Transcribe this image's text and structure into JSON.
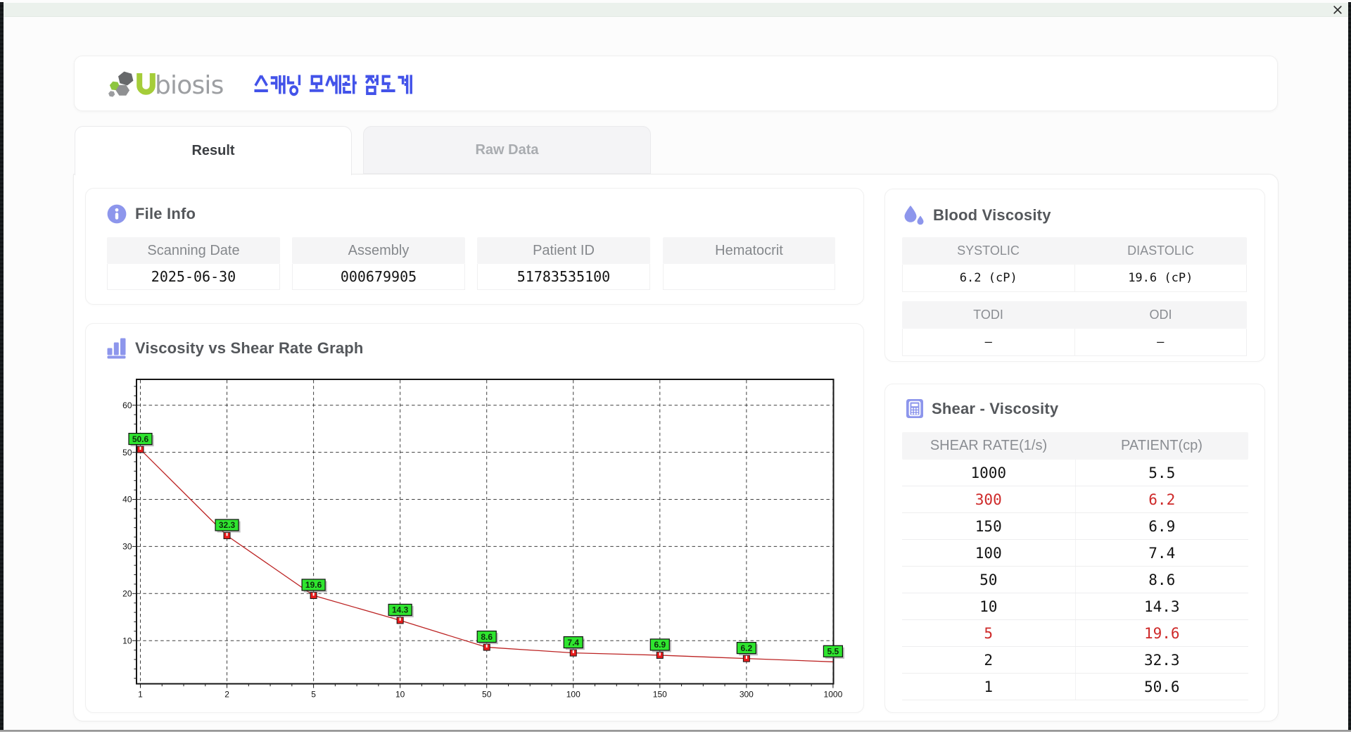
{
  "window": {
    "titlebar_color": "#ebf1ec",
    "close_label": "close"
  },
  "header": {
    "logo_u": "U",
    "logo_rest": "biosis",
    "app_title_korean": "스캐닝 모세관 점도계"
  },
  "tabs": [
    {
      "id": "result",
      "label": "Result",
      "active": true
    },
    {
      "id": "raw-data",
      "label": "Raw Data",
      "active": false
    }
  ],
  "file_info": {
    "title": "File Info",
    "fields": [
      {
        "label": "Scanning Date",
        "value": "2025-06-30"
      },
      {
        "label": "Assembly",
        "value": "000679905"
      },
      {
        "label": "Patient ID",
        "value": "51783535100"
      },
      {
        "label": "Hematocrit",
        "value": ""
      }
    ]
  },
  "blood_viscosity": {
    "title": "Blood Viscosity",
    "tables": [
      {
        "columns": [
          "SYSTOLIC",
          "DIASTOLIC"
        ],
        "values": [
          "6.2 (cP)",
          "19.6 (cP)"
        ]
      },
      {
        "columns": [
          "TODI",
          "ODI"
        ],
        "values": [
          "–",
          "–"
        ]
      }
    ]
  },
  "shear_viscosity": {
    "title": "Shear - Viscosity",
    "columns": [
      "SHEAR RATE(1/s)",
      "PATIENT(cp)"
    ],
    "rows": [
      {
        "shear_rate": "1000",
        "patient": "5.5",
        "highlight": false
      },
      {
        "shear_rate": "300",
        "patient": "6.2",
        "highlight": true
      },
      {
        "shear_rate": "150",
        "patient": "6.9",
        "highlight": false
      },
      {
        "shear_rate": "100",
        "patient": "7.4",
        "highlight": false
      },
      {
        "shear_rate": "50",
        "patient": "8.6",
        "highlight": false
      },
      {
        "shear_rate": "10",
        "patient": "14.3",
        "highlight": false
      },
      {
        "shear_rate": "5",
        "patient": "19.6",
        "highlight": true
      },
      {
        "shear_rate": "2",
        "patient": "32.3",
        "highlight": false
      },
      {
        "shear_rate": "1",
        "patient": "50.6",
        "highlight": false
      }
    ],
    "highlight_color": "#ce2929"
  },
  "chart_data": {
    "type": "line",
    "title": "Viscosity vs Shear Rate Graph",
    "x_categories": [
      1,
      2,
      5,
      10,
      50,
      100,
      150,
      300,
      1000
    ],
    "values": [
      50.6,
      32.3,
      19.6,
      14.3,
      8.6,
      7.4,
      6.9,
      6.2,
      5.5
    ],
    "point_labels": [
      "50.6",
      "32.3",
      "19.6",
      "14.3",
      "8.6",
      "7.4",
      "6.9",
      "6.2",
      "5.5"
    ],
    "y_ticks": [
      10,
      20,
      30,
      40,
      50,
      60
    ],
    "ylim": [
      0.8,
      65.6
    ],
    "grid": "dashed",
    "legend": "none",
    "line_color": "#bc2323",
    "marker_color": "#e91c1c",
    "marker_border": "#161616",
    "label_bg": "#2fe52f",
    "label_border": "#101010",
    "xlabel": "",
    "ylabel": ""
  }
}
